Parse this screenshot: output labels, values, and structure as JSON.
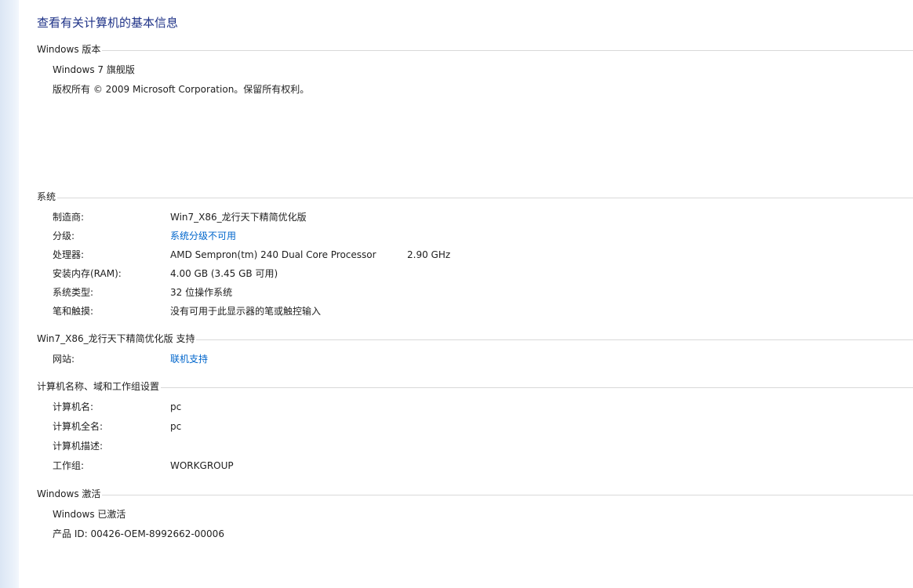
{
  "page_title": "查看有关计算机的基本信息",
  "windows_edition": {
    "header": "Windows 版本",
    "edition": "Windows 7 旗舰版",
    "copyright": "版权所有 © 2009 Microsoft Corporation。保留所有权利。"
  },
  "system": {
    "header": "系统",
    "rows": [
      {
        "label": "制造商:",
        "value": "Win7_X86_龙行天下精简优化版"
      },
      {
        "label": "分级:",
        "value": "系统分级不可用"
      },
      {
        "label": "处理器:",
        "value": "AMD Sempron(tm) 240 Dual Core Processor",
        "value2": "2.90 GHz"
      },
      {
        "label": "安装内存(RAM):",
        "value": "4.00 GB (3.45 GB 可用)"
      },
      {
        "label": "系统类型:",
        "value": "32 位操作系统"
      },
      {
        "label": "笔和触摸:",
        "value": "没有可用于此显示器的笔或触控输入"
      }
    ]
  },
  "support": {
    "header": "Win7_X86_龙行天下精简优化版 支持",
    "rows": [
      {
        "label": "网站:",
        "value": "联机支持"
      }
    ]
  },
  "computer_name": {
    "header": "计算机名称、域和工作组设置",
    "rows": [
      {
        "label": "计算机名:",
        "value": "pc"
      },
      {
        "label": "计算机全名:",
        "value": "pc"
      },
      {
        "label": "计算机描述:",
        "value": ""
      },
      {
        "label": "工作组:",
        "value": "WORKGROUP"
      }
    ]
  },
  "activation": {
    "header": "Windows 激活",
    "status": "Windows 已激活",
    "product_id": "产品 ID: 00426-OEM-8992662-00006"
  },
  "colors": {
    "title": "#1e3287",
    "link": "#0066cc",
    "rule": "#d9d9d9"
  }
}
